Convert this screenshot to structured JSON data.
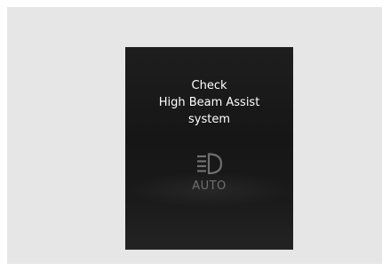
{
  "warning": {
    "lines": [
      "Check",
      "High Beam Assist",
      "system"
    ]
  },
  "indicator": {
    "icon": "high-beam-icon",
    "label": "AUTO",
    "color": "#6f6f6f"
  },
  "colors": {
    "outer_frame": "#e6e6e6",
    "screen_background": "#1a1a1a",
    "message_text": "#ffffff"
  }
}
